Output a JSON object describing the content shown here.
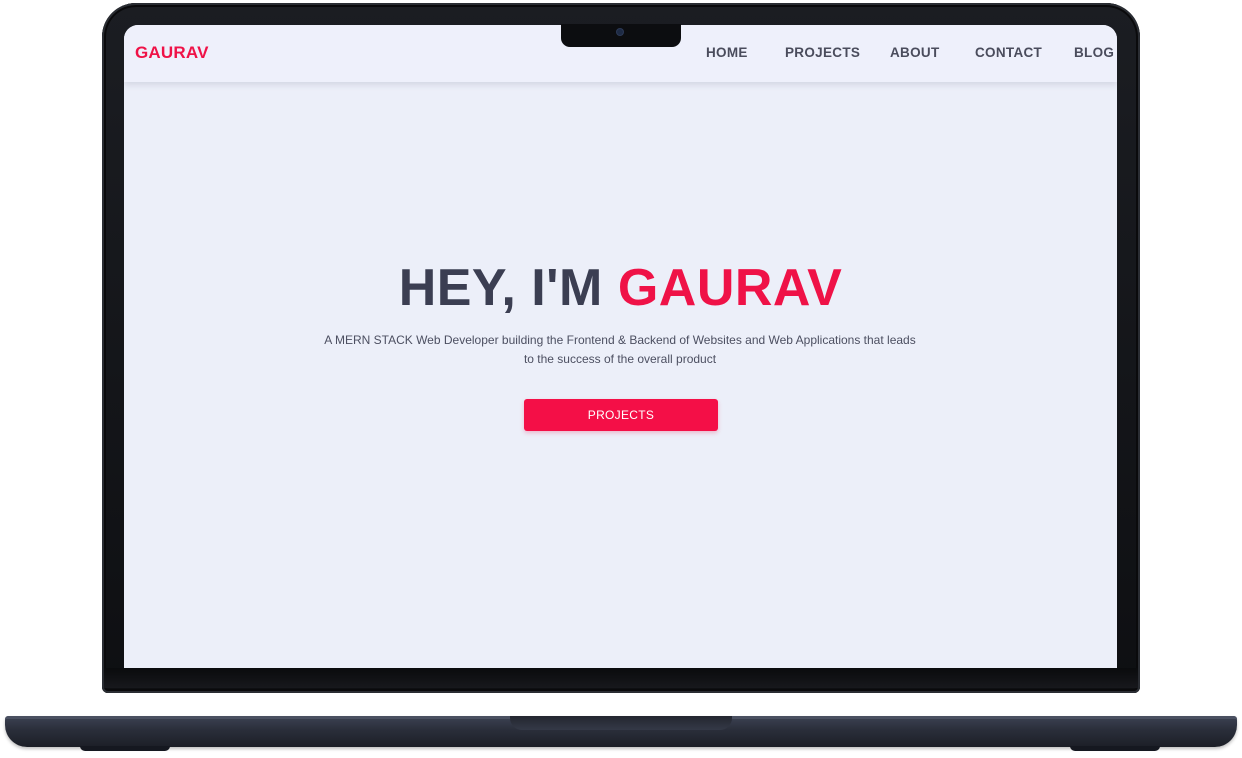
{
  "header": {
    "brand": "GAURAV",
    "nav": [
      "HOME",
      "PROJECTS",
      "ABOUT",
      "CONTACT",
      "BLOG"
    ]
  },
  "hero": {
    "title_prefix": "HEY, I'M ",
    "title_name": "GAURAV",
    "subtitle": "A MERN STACK Web Developer building the Frontend & Backend of Websites and Web Applications that leads to the success of the overall product",
    "cta_label": "PROJECTS"
  },
  "colors": {
    "accent": "#ef1247",
    "background": "#eceff9",
    "text": "#3b3e52"
  }
}
